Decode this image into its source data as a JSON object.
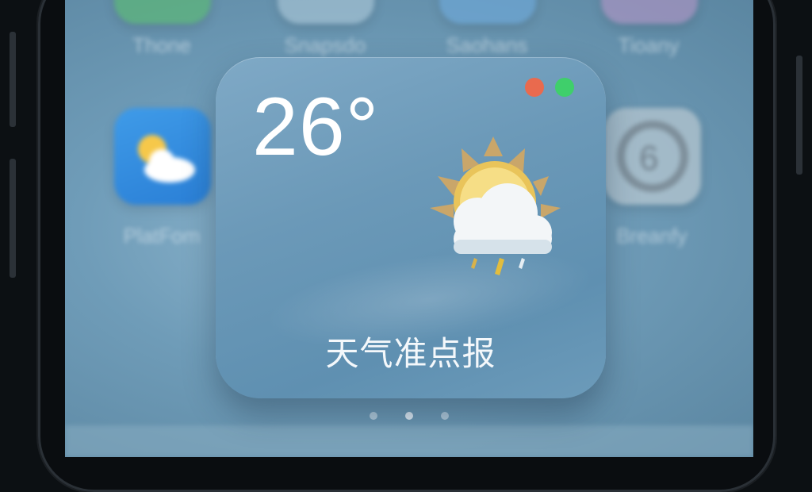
{
  "background_apps": [
    {
      "label": "Thone"
    },
    {
      "label": "Snapsdo"
    },
    {
      "label": "Saohans"
    },
    {
      "label": "Tioany"
    },
    {
      "label": "PlatFom"
    },
    {
      "label": "Breanfy"
    }
  ],
  "widget": {
    "temperature": "26°",
    "app_name": "天气准点报",
    "condition_icon": "sun-behind-rain-cloud-icon"
  },
  "window_controls": {
    "close_color": "#e96a4e",
    "maximize_color": "#3fcf6b"
  },
  "page_indicator": {
    "pages": 3,
    "current": 2
  }
}
